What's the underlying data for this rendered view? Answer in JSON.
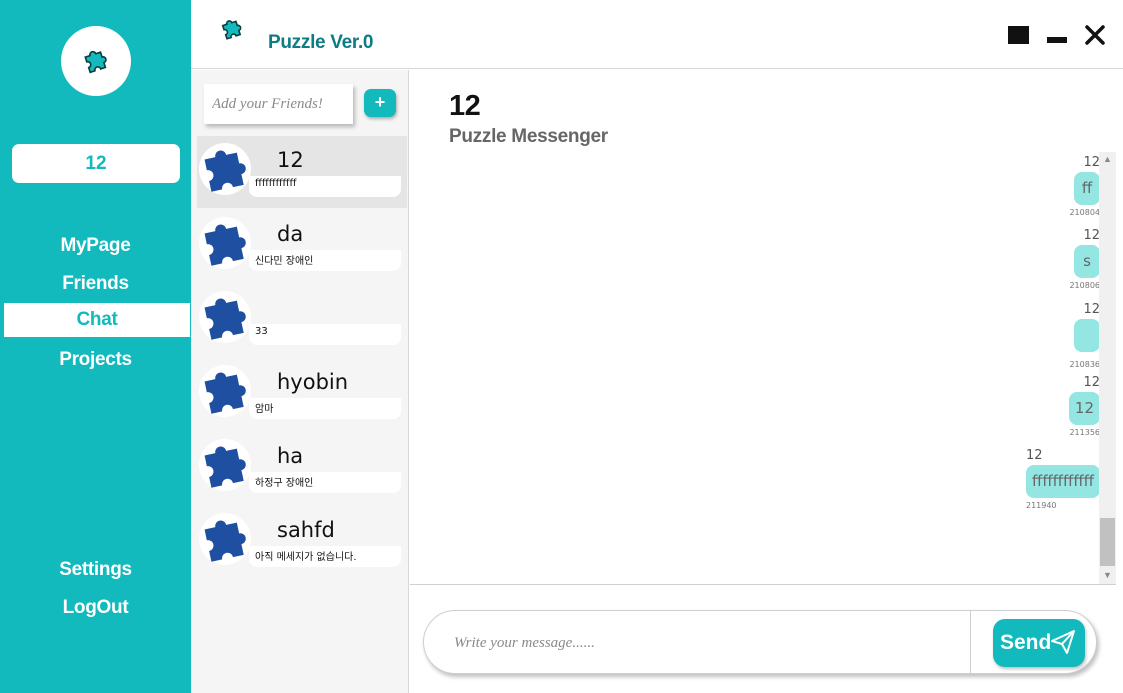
{
  "app": {
    "title": "Puzzle Ver.0"
  },
  "sidebar": {
    "user_name": "12",
    "nav": [
      {
        "label": "MyPage"
      },
      {
        "label": "Friends"
      },
      {
        "label": "Chat",
        "active": true
      },
      {
        "label": "Projects"
      }
    ],
    "bottom_nav": [
      {
        "label": "Settings"
      },
      {
        "label": "LogOut"
      }
    ]
  },
  "friends": {
    "add_placeholder": "Add your Friends!",
    "add_button": "+",
    "list": [
      {
        "name": "12",
        "preview": "ffffffffffff",
        "selected": true
      },
      {
        "name": "da",
        "preview": "신다민 장애인"
      },
      {
        "name": "",
        "preview": "33"
      },
      {
        "name": "hyobin",
        "preview": "암마"
      },
      {
        "name": "ha",
        "preview": "하정구 장애인"
      },
      {
        "name": "sahfd",
        "preview": "아직 메세지가 없습니다."
      }
    ]
  },
  "chat": {
    "room_title": "12",
    "subtitle": "Puzzle Messenger",
    "messages": [
      {
        "sender": "12",
        "text": "ff",
        "time": "210804"
      },
      {
        "sender": "12",
        "text": "s",
        "time": "210806"
      },
      {
        "sender": "12",
        "text": "",
        "time": "210836"
      },
      {
        "sender": "12",
        "text": "12",
        "time": "211356"
      },
      {
        "sender": "12",
        "text": "ffffffffffff",
        "time": "211940"
      }
    ],
    "input_placeholder": "Write your message......",
    "send_label": "Send"
  },
  "colors": {
    "accent": "#12b9bd",
    "title": "#0d7c85",
    "bubble": "#94e6e3",
    "avatar": "#1f4fa0"
  },
  "icons": {
    "logo": "puzzle-piece-icon",
    "avatar": "puzzle-piece-icon",
    "send": "paper-plane-icon",
    "window": [
      "maximize-icon",
      "minimize-icon",
      "close-icon"
    ]
  }
}
